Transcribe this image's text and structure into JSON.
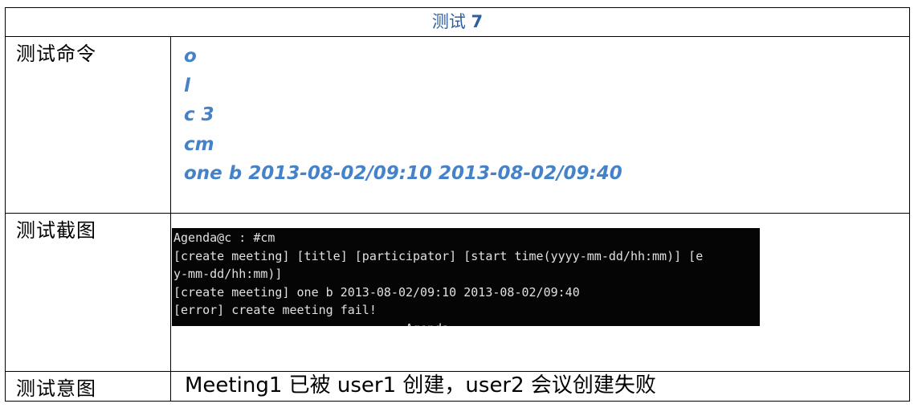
{
  "header": {
    "title_prefix": "测试",
    "title_number": "7"
  },
  "rows": {
    "commands": {
      "label": "测试命令",
      "lines": [
        "o",
        "l",
        "c 3",
        "cm",
        "one b 2013-08-02/09:10 2013-08-02/09:40"
      ]
    },
    "screenshot": {
      "label": "测试截图",
      "terminal_lines": [
        "Agenda@c : #cm",
        "[create meeting] [title] [participator] [start time(yyyy-mm-dd/hh:mm)] [e",
        "y-mm-dd/hh:mm)]",
        "[create meeting] one b 2013-08-02/09:10 2013-08-02/09:40",
        "[error] create meeting fail!",
        "--------------------------------Agenda------------------------------"
      ]
    },
    "intent": {
      "label": "测试意图",
      "text": "Meeting1 已被 user1 创建，user2 会议创建失败"
    }
  },
  "colors": {
    "header_text": "#2e5fa4",
    "command_text": "#4682c8",
    "terminal_bg": "#050505",
    "terminal_text": "#e0e0e0",
    "border": "#000000"
  }
}
